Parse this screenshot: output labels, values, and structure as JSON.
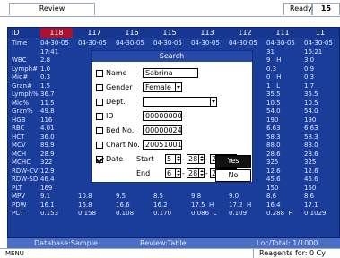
{
  "top": {
    "review": "Review",
    "ready": "Ready",
    "count": "15"
  },
  "grid": {
    "id_label": "ID",
    "sample_ids": [
      "118",
      "117",
      "116",
      "115",
      "113",
      "112",
      "111",
      "11"
    ],
    "row_labels": [
      "Time",
      "",
      "WBC",
      "Lymph#",
      "Mid#",
      "Gran#",
      "Lymph%",
      "Mid%",
      "Gran%",
      "HGB",
      "RBC",
      "HCT",
      "MCV",
      "MCH",
      "MCHC",
      "RDW-CV",
      "RDW-SD",
      "PLT",
      "MPV",
      "PDW",
      "PCT"
    ],
    "col0": [
      "04-30-05",
      "17:41",
      "2.8",
      "1.0",
      "0.3",
      "1.5",
      "36.7",
      "11.5",
      "49.8",
      "116",
      "4.01",
      "36.0",
      "89.9",
      "28.9",
      "322",
      "12.9",
      "46.4",
      "169",
      "9.1",
      "16.1",
      "0.153"
    ],
    "col1": [
      "04-30-05",
      "",
      "",
      "",
      "",
      "",
      "",
      "",
      "",
      "",
      "",
      "",
      "",
      "",
      "",
      "",
      "",
      "",
      "10.8",
      "16.8",
      "0.158"
    ],
    "col2": [
      "04-30-05",
      "",
      "",
      "",
      "",
      "",
      "",
      "",
      "",
      "",
      "",
      "",
      "",
      "",
      "",
      "",
      "",
      "",
      "9.5",
      "16.6",
      "0.108"
    ],
    "col3": [
      "04-30-05",
      "",
      "",
      "",
      "",
      "",
      "",
      "",
      "",
      "",
      "",
      "",
      "",
      "",
      "",
      "",
      "",
      "",
      "8.5",
      "16.2",
      "0.170"
    ],
    "col4": [
      "04-30-05",
      "",
      "",
      "",
      "",
      "",
      "",
      "",
      "",
      "",
      "",
      "",
      "",
      "",
      "",
      "",
      "",
      "",
      "9.8",
      "17.5  H",
      "0.086  L"
    ],
    "col5": [
      "04-30-05",
      "",
      "",
      "",
      "",
      "",
      "",
      "",
      "",
      "",
      "",
      "",
      "",
      "",
      "",
      "",
      "",
      "",
      "9.0",
      "17.2  H",
      "0.109"
    ],
    "col6": [
      "04-30-05",
      "31",
      "9   H",
      "0.3",
      "0   H",
      "1   L",
      "35.5",
      "10.5",
      "54.0",
      "190",
      "6.63",
      "58.3",
      "88.0",
      "28.6",
      "325",
      "12.6",
      "45.6",
      "150",
      "8.6",
      "16.4",
      "0.288  H"
    ],
    "col7": [
      "04-30-05",
      "16:21",
      "3.0",
      "0.9",
      "0.3",
      "1.7",
      "35.5",
      "10.5",
      "54.0",
      "190",
      "6.63",
      "58.3",
      "88.0",
      "28.6",
      "325",
      "12.6",
      "45.6",
      "150",
      "8.6",
      "17.1",
      "0.1029"
    ]
  },
  "status": {
    "database": "Database:Sample",
    "review": "Review:Table",
    "loc_total": "Loc/Total:  1/1000"
  },
  "reagents": "Reagents for:   0 Cy",
  "menu": "MENU",
  "dialog": {
    "title": "Search",
    "name_label": "Name",
    "name_value": "Sabrina",
    "gender_label": "Gender",
    "gender_value": "Female",
    "dept_label": "Dept.",
    "dept_value": "",
    "id_label": "ID",
    "id_value": "00000000",
    "bed_label": "Bed No.",
    "bed_value": "00000024",
    "chart_label": "Chart No.",
    "chart_value": "20051001",
    "date_label": "Date",
    "start_label": "Start",
    "start_m": "5",
    "start_d": "28",
    "start_y": "2005",
    "end_label": "End",
    "end_m": "6",
    "end_d": "28",
    "end_y": "2005",
    "yes": "Yes",
    "no": "No"
  }
}
